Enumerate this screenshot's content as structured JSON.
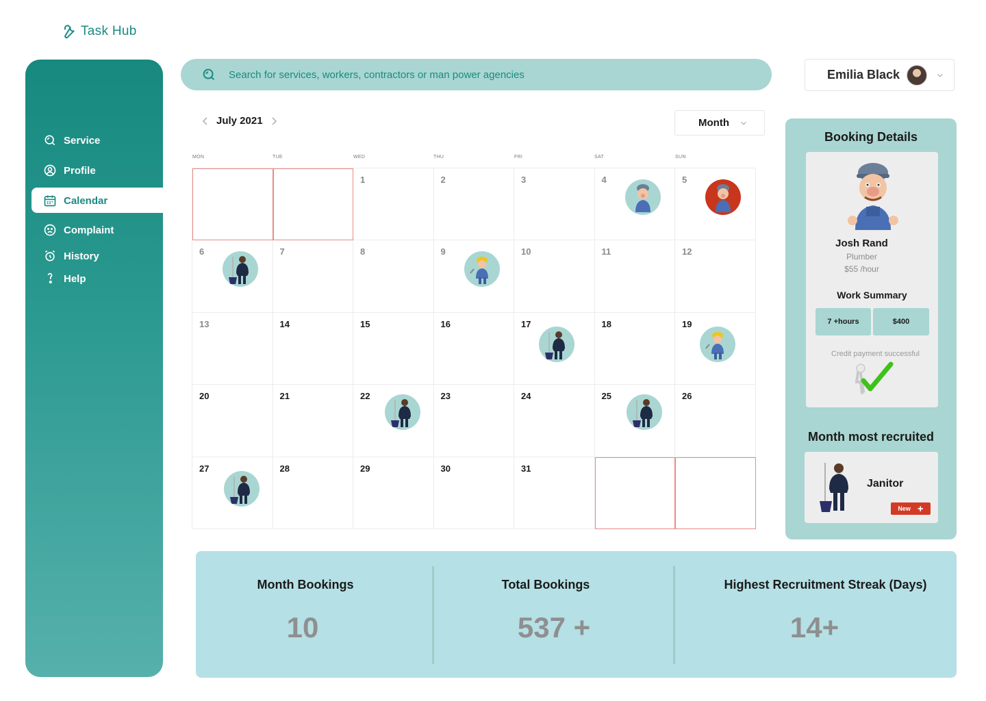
{
  "app": {
    "name": "Task Hub"
  },
  "sidebar": {
    "items": [
      {
        "label": "Service",
        "icon": "search-icon"
      },
      {
        "label": "Profile",
        "icon": "user-circle-icon"
      },
      {
        "label": "Calendar",
        "icon": "calendar-icon",
        "active": true
      },
      {
        "label": "Complaint",
        "icon": "sad-face-icon"
      },
      {
        "label": "History",
        "icon": "alarm-clock-icon"
      },
      {
        "label": "Help",
        "icon": "help-icon"
      }
    ]
  },
  "search": {
    "placeholder": "Search for services, workers, contractors or man power agencies"
  },
  "user": {
    "name": "Emilia Black"
  },
  "calendar": {
    "month_label": "July 2021",
    "view": "Month",
    "weekdays": [
      "MON",
      "TUE",
      "WED",
      "THU",
      "FRI",
      "SAT",
      "SUN"
    ],
    "weeks": [
      [
        null,
        null,
        "1",
        "2",
        "3",
        "4",
        "5"
      ],
      [
        "6",
        "7",
        "8",
        "9",
        "10",
        "11",
        "12"
      ],
      [
        "13",
        "14",
        "15",
        "16",
        "17",
        "18",
        "19"
      ],
      [
        "20",
        "21",
        "22",
        "23",
        "24",
        "25",
        "26"
      ],
      [
        "27",
        "28",
        "29",
        "30",
        "31",
        null,
        null
      ]
    ],
    "bookings": [
      {
        "day": "4",
        "worker": "plumber"
      },
      {
        "day": "5",
        "worker": "plumber",
        "highlight": true
      },
      {
        "day": "6",
        "worker": "janitor"
      },
      {
        "day": "9",
        "worker": "electrician"
      },
      {
        "day": "17",
        "worker": "janitor"
      },
      {
        "day": "19",
        "worker": "electrician"
      },
      {
        "day": "22",
        "worker": "janitor"
      },
      {
        "day": "25",
        "worker": "janitor"
      },
      {
        "day": "27",
        "worker": "janitor"
      }
    ]
  },
  "booking_details": {
    "title": "Booking Details",
    "worker_name": "Josh Rand",
    "worker_role": "Plumber",
    "worker_rate": "$55 /hour",
    "summary_title": "Work Summary",
    "hours": "7 +hours",
    "amount": "$400",
    "payment_status": "Credit payment successful"
  },
  "most_recruited": {
    "title": "Month most recruited",
    "label": "Janitor",
    "button_label": "New"
  },
  "stats": [
    {
      "label": "Month Bookings",
      "value": "10"
    },
    {
      "label": "Total Bookings",
      "value": "537 +"
    },
    {
      "label": "Highest Recruitment Streak (Days)",
      "value": "14+"
    }
  ],
  "colors": {
    "primary": "#1a8a82",
    "panel": "#a9d6d2",
    "stats_bg": "#b5e0e5",
    "outside_border": "#e88a86",
    "accent_red": "#d33a25"
  }
}
